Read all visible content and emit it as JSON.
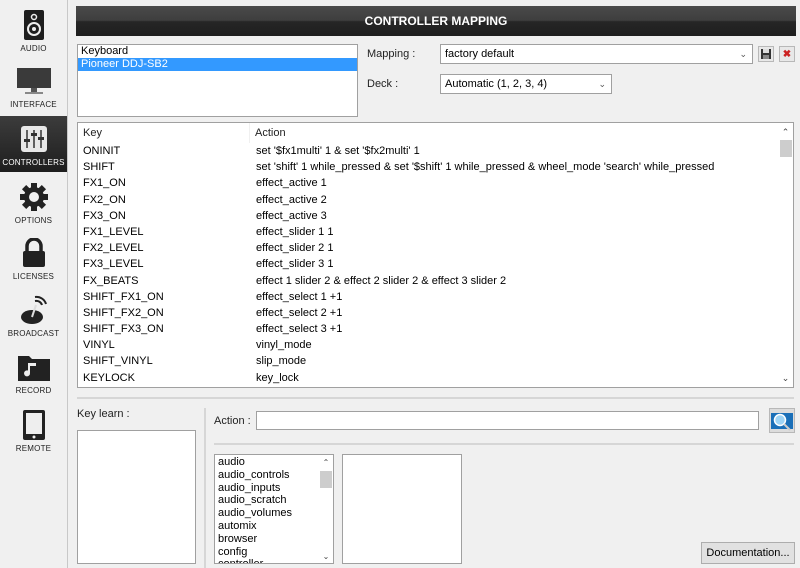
{
  "sidebar": {
    "items": [
      {
        "label": "AUDIO",
        "icon": "speaker-icon",
        "active": false
      },
      {
        "label": "INTERFACE",
        "icon": "monitor-icon",
        "active": false
      },
      {
        "label": "CONTROLLERS",
        "icon": "mixer-sliders-icon",
        "active": true
      },
      {
        "label": "OPTIONS",
        "icon": "gear-icon",
        "active": false
      },
      {
        "label": "LICENSES",
        "icon": "lock-icon",
        "active": false
      },
      {
        "label": "BROADCAST",
        "icon": "broadcast-dish-icon",
        "active": false
      },
      {
        "label": "RECORD",
        "icon": "music-folder-icon",
        "active": false
      },
      {
        "label": "REMOTE",
        "icon": "tablet-icon",
        "active": false
      }
    ]
  },
  "header": {
    "title": "CONTROLLER MAPPING"
  },
  "devices": {
    "items": [
      "Keyboard",
      "Pioneer DDJ-SB2"
    ],
    "selected": "Pioneer DDJ-SB2"
  },
  "mapping": {
    "label": "Mapping :",
    "value": "factory default"
  },
  "deck": {
    "label": "Deck :",
    "value": "Automatic (1, 2, 3, 4)"
  },
  "table": {
    "columns": [
      "Key",
      "Action"
    ],
    "rows": [
      {
        "key": "ONINIT",
        "action": "set '$fx1multi' 1 & set '$fx2multi' 1"
      },
      {
        "key": "SHIFT",
        "action": "set 'shift' 1 while_pressed & set '$shift' 1 while_pressed & wheel_mode 'search' while_pressed"
      },
      {
        "key": "FX1_ON",
        "action": "effect_active 1"
      },
      {
        "key": "FX2_ON",
        "action": "effect_active 2"
      },
      {
        "key": "FX3_ON",
        "action": "effect_active 3"
      },
      {
        "key": "FX1_LEVEL",
        "action": "effect_slider 1 1"
      },
      {
        "key": "FX2_LEVEL",
        "action": "effect_slider 2 1"
      },
      {
        "key": "FX3_LEVEL",
        "action": "effect_slider 3 1"
      },
      {
        "key": "FX_BEATS",
        "action": "effect 1 slider 2 & effect 2 slider 2 & effect 3 slider 2"
      },
      {
        "key": "SHIFT_FX1_ON",
        "action": "effect_select 1 +1"
      },
      {
        "key": "SHIFT_FX2_ON",
        "action": "effect_select 2 +1"
      },
      {
        "key": "SHIFT_FX3_ON",
        "action": "effect_select 3 +1"
      },
      {
        "key": "VINYL",
        "action": "vinyl_mode"
      },
      {
        "key": "SHIFT_VINYL",
        "action": "slip_mode"
      },
      {
        "key": "KEYLOCK",
        "action": "key_lock"
      }
    ]
  },
  "key_learn": {
    "label": "Key learn :"
  },
  "action": {
    "label": "Action :",
    "value": ""
  },
  "categories": [
    "audio",
    "audio_controls",
    "audio_inputs",
    "audio_scratch",
    "audio_volumes",
    "automix",
    "browser",
    "config",
    "controller"
  ],
  "buttons": {
    "documentation": "Documentation..."
  }
}
